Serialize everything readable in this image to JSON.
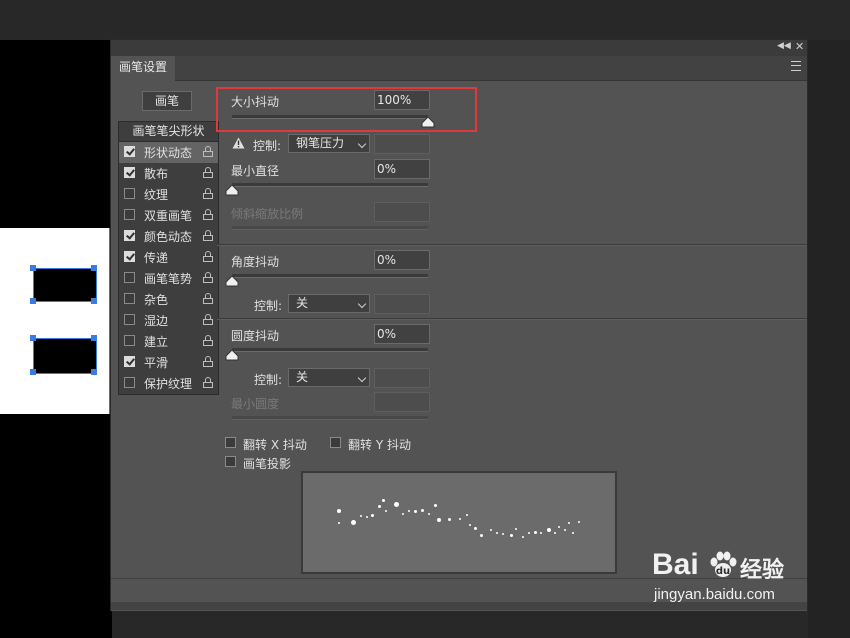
{
  "panel": {
    "title_tab": "画笔设置",
    "brush_button": "画笔",
    "list_header": "画笔笔尖形状",
    "items": [
      {
        "label": "形状动态",
        "checked": true,
        "selected": true
      },
      {
        "label": "散布",
        "checked": true,
        "selected": false
      },
      {
        "label": "纹理",
        "checked": false,
        "selected": false
      },
      {
        "label": "双重画笔",
        "checked": false,
        "selected": false
      },
      {
        "label": "颜色动态",
        "checked": true,
        "selected": false
      },
      {
        "label": "传递",
        "checked": true,
        "selected": false
      },
      {
        "label": "画笔笔势",
        "checked": false,
        "selected": false
      },
      {
        "label": "杂色",
        "checked": false,
        "selected": false
      },
      {
        "label": "湿边",
        "checked": false,
        "selected": false
      },
      {
        "label": "建立",
        "checked": false,
        "selected": false
      },
      {
        "label": "平滑",
        "checked": true,
        "selected": false
      },
      {
        "label": "保护纹理",
        "checked": false,
        "selected": false
      }
    ]
  },
  "settings": {
    "size_jitter": {
      "label": "大小抖动",
      "value": "100%",
      "level": 1.0
    },
    "control1": {
      "label": "控制:",
      "value": "钢笔压力",
      "warning": true
    },
    "min_diameter": {
      "label": "最小直径",
      "value": "0%",
      "level": 0.0
    },
    "tilt_scale": {
      "label": "倾斜缩放比例",
      "value": ""
    },
    "angle_jitter": {
      "label": "角度抖动",
      "value": "0%",
      "level": 0.0
    },
    "control2": {
      "label": "控制:",
      "value": "关"
    },
    "roundness_jitter": {
      "label": "圆度抖动",
      "value": "0%",
      "level": 0.0
    },
    "control3": {
      "label": "控制:",
      "value": "关"
    },
    "min_roundness": {
      "label": "最小圆度",
      "value": ""
    },
    "flip_x": {
      "label": "翻转 X 抖动",
      "checked": false
    },
    "flip_y": {
      "label": "翻转 Y 抖动",
      "checked": false
    },
    "brush_projection": {
      "label": "画笔投影",
      "checked": false
    }
  },
  "watermark": {
    "brand": "Bai",
    "brand_cn": "经验",
    "url": "jingyan.baidu.com"
  },
  "colors": {
    "panel": "#535353",
    "highlight": "#e0393b",
    "selection": "#3a7be0"
  }
}
